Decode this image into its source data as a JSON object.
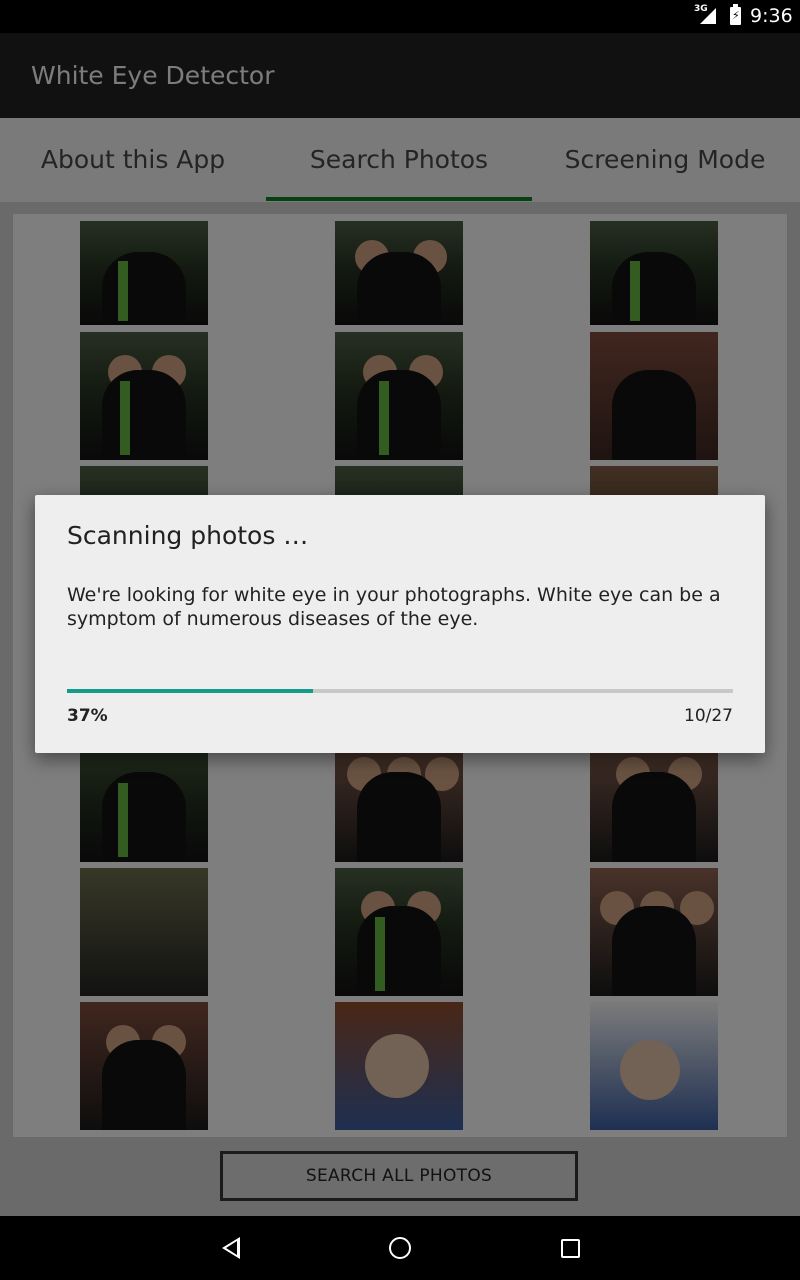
{
  "status_bar": {
    "network": "3G",
    "time": "9:36",
    "icons": [
      "signal-icon",
      "battery-charging-icon"
    ]
  },
  "app_bar": {
    "title": "White Eye Detector"
  },
  "tabs": [
    {
      "label": "About this App",
      "selected": false
    },
    {
      "label": "Search Photos",
      "selected": true
    },
    {
      "label": "Screening Mode",
      "selected": false
    }
  ],
  "colors": {
    "accent": "#0b7d1e",
    "progress": "#139b8c",
    "app_bar": "#212121"
  },
  "photos": {
    "rows_visible": 7,
    "columns": 3,
    "items": [
      "graduate-photo",
      "graduate-photo",
      "graduate-photo",
      "graduate-photo",
      "graduate-photo",
      "graduate-photo",
      "graduate-photo",
      "graduate-photo",
      "graduate-photo",
      "graduate-photo",
      "graduate-photo",
      "graduate-photo",
      "graduate-photo",
      "graduate-photo",
      "graduate-photo",
      "graduate-photo",
      "graduate-photo",
      "graduate-photo",
      "graduate-photo",
      "baby-photo",
      "baby-photo"
    ]
  },
  "search_all_button": {
    "label": "SEARCH ALL PHOTOS"
  },
  "dialog": {
    "title": "Scanning photos …",
    "message": "We're looking for white eye in your photographs. White eye can be a symptom of numerous diseases of the eye.",
    "progress_fraction": 0.37,
    "percent_label": "37%",
    "count_label": "10/27"
  },
  "nav_bar": {
    "icons": [
      "back-icon",
      "home-icon",
      "recent-apps-icon"
    ]
  }
}
